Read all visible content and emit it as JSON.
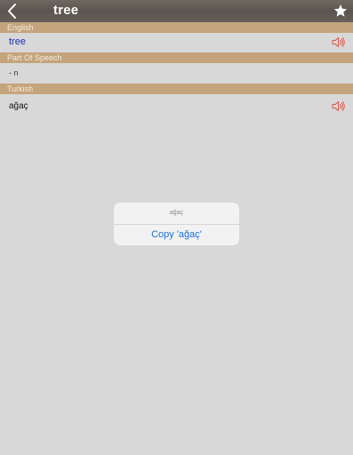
{
  "header": {
    "title": "tree"
  },
  "sections": {
    "english": {
      "label": "English",
      "word": "tree"
    },
    "part_of_speech": {
      "label": "Part Of Speech",
      "value": "- n"
    },
    "turkish": {
      "label": "Turkish",
      "word": "ağaç"
    }
  },
  "dialog": {
    "message": "ağaç",
    "copy_label": "Copy 'ağaç'"
  },
  "colors": {
    "section_header": "#c4a47c",
    "english_word": "#1b2fb0",
    "speaker_icon": "#e04a3a",
    "dialog_button": "#1a6ed8"
  },
  "icons": {
    "back": "chevron-left-icon",
    "favorite": "star-icon",
    "speaker": "speaker-icon"
  }
}
